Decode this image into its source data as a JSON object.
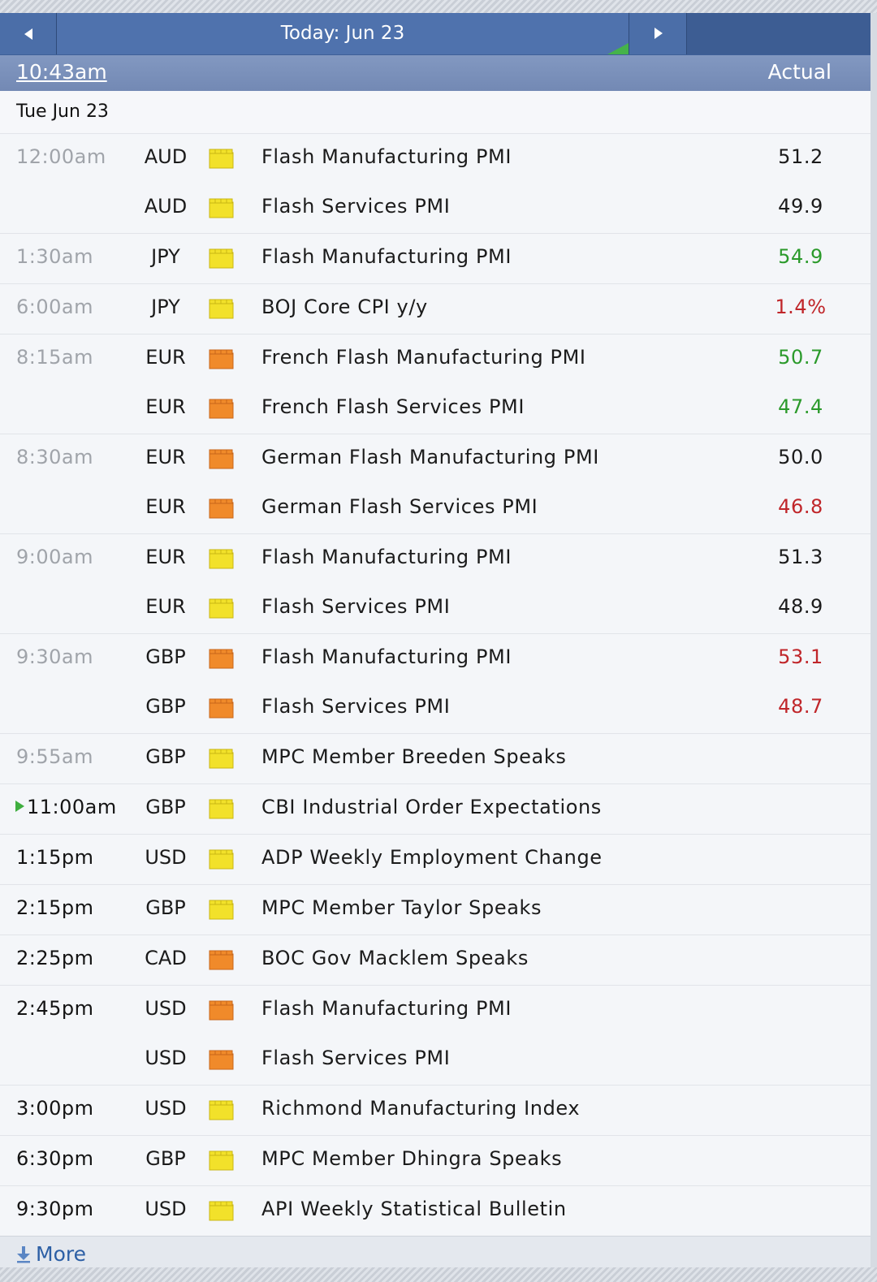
{
  "nav": {
    "prev_icon": "chevron-left-icon",
    "title": "Today: Jun 23",
    "next_icon": "chevron-right-icon"
  },
  "header": {
    "clock": "10:43am",
    "actual_label": "Actual"
  },
  "day_label": "Tue Jun 23",
  "colors": {
    "impact_low": "#f2e12a",
    "impact_medium": "#f08a2a",
    "better": "#2b9a2b",
    "worse": "#c0262a"
  },
  "groups": [
    {
      "time": "12:00am",
      "state": "past",
      "events": [
        {
          "currency": "AUD",
          "impact": "low",
          "title": "Flash Manufacturing PMI",
          "actual": "51.2",
          "direction": "neutral"
        },
        {
          "currency": "AUD",
          "impact": "low",
          "title": "Flash Services PMI",
          "actual": "49.9",
          "direction": "neutral"
        }
      ]
    },
    {
      "time": "1:30am",
      "state": "past",
      "events": [
        {
          "currency": "JPY",
          "impact": "low",
          "title": "Flash Manufacturing PMI",
          "actual": "54.9",
          "direction": "better"
        }
      ]
    },
    {
      "time": "6:00am",
      "state": "past",
      "events": [
        {
          "currency": "JPY",
          "impact": "low",
          "title": "BOJ Core CPI y/y",
          "actual": "1.4%",
          "direction": "worse"
        }
      ]
    },
    {
      "time": "8:15am",
      "state": "past",
      "events": [
        {
          "currency": "EUR",
          "impact": "medium",
          "title": "French Flash Manufacturing PMI",
          "actual": "50.7",
          "direction": "better"
        },
        {
          "currency": "EUR",
          "impact": "medium",
          "title": "French Flash Services PMI",
          "actual": "47.4",
          "direction": "better"
        }
      ]
    },
    {
      "time": "8:30am",
      "state": "past",
      "events": [
        {
          "currency": "EUR",
          "impact": "medium",
          "title": "German Flash Manufacturing PMI",
          "actual": "50.0",
          "direction": "neutral"
        },
        {
          "currency": "EUR",
          "impact": "medium",
          "title": "German Flash Services PMI",
          "actual": "46.8",
          "direction": "worse"
        }
      ]
    },
    {
      "time": "9:00am",
      "state": "past",
      "events": [
        {
          "currency": "EUR",
          "impact": "low",
          "title": "Flash Manufacturing PMI",
          "actual": "51.3",
          "direction": "neutral"
        },
        {
          "currency": "EUR",
          "impact": "low",
          "title": "Flash Services PMI",
          "actual": "48.9",
          "direction": "neutral"
        }
      ]
    },
    {
      "time": "9:30am",
      "state": "past",
      "events": [
        {
          "currency": "GBP",
          "impact": "medium",
          "title": "Flash Manufacturing PMI",
          "actual": "53.1",
          "direction": "worse"
        },
        {
          "currency": "GBP",
          "impact": "medium",
          "title": "Flash Services PMI",
          "actual": "48.7",
          "direction": "worse"
        }
      ]
    },
    {
      "time": "9:55am",
      "state": "past",
      "events": [
        {
          "currency": "GBP",
          "impact": "low",
          "title": "MPC Member Breeden Speaks",
          "actual": "",
          "direction": "neutral"
        }
      ]
    },
    {
      "time": "11:00am",
      "state": "next",
      "events": [
        {
          "currency": "GBP",
          "impact": "low",
          "title": "CBI Industrial Order Expectations",
          "actual": "",
          "direction": "neutral"
        }
      ]
    },
    {
      "time": "1:15pm",
      "state": "upcoming",
      "events": [
        {
          "currency": "USD",
          "impact": "low",
          "title": "ADP Weekly Employment Change",
          "actual": "",
          "direction": "neutral"
        }
      ]
    },
    {
      "time": "2:15pm",
      "state": "upcoming",
      "events": [
        {
          "currency": "GBP",
          "impact": "low",
          "title": "MPC Member Taylor Speaks",
          "actual": "",
          "direction": "neutral"
        }
      ]
    },
    {
      "time": "2:25pm",
      "state": "upcoming",
      "events": [
        {
          "currency": "CAD",
          "impact": "medium",
          "title": "BOC Gov Macklem Speaks",
          "actual": "",
          "direction": "neutral"
        }
      ]
    },
    {
      "time": "2:45pm",
      "state": "upcoming",
      "events": [
        {
          "currency": "USD",
          "impact": "medium",
          "title": "Flash Manufacturing PMI",
          "actual": "",
          "direction": "neutral"
        },
        {
          "currency": "USD",
          "impact": "medium",
          "title": "Flash Services PMI",
          "actual": "",
          "direction": "neutral"
        }
      ]
    },
    {
      "time": "3:00pm",
      "state": "upcoming",
      "events": [
        {
          "currency": "USD",
          "impact": "low",
          "title": "Richmond Manufacturing Index",
          "actual": "",
          "direction": "neutral"
        }
      ]
    },
    {
      "time": "6:30pm",
      "state": "upcoming",
      "events": [
        {
          "currency": "GBP",
          "impact": "low",
          "title": "MPC Member Dhingra Speaks",
          "actual": "",
          "direction": "neutral"
        }
      ]
    },
    {
      "time": "9:30pm",
      "state": "upcoming",
      "events": [
        {
          "currency": "USD",
          "impact": "low",
          "title": "API Weekly Statistical Bulletin",
          "actual": "",
          "direction": "neutral"
        }
      ]
    }
  ],
  "more": {
    "icon": "download-arrow-icon",
    "label": "More"
  }
}
